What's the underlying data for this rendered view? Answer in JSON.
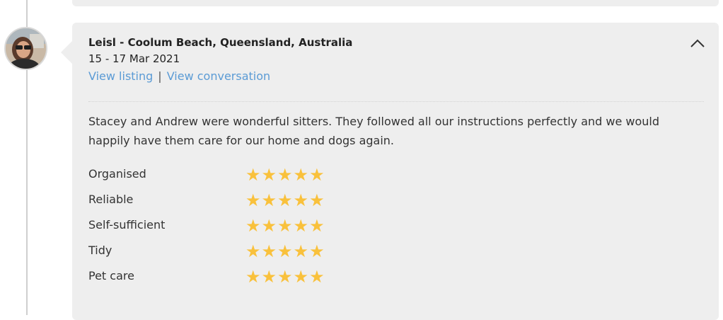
{
  "review": {
    "reviewer": "Leisl - Coolum Beach, Queensland, Australia",
    "dates": "15 - 17 Mar 2021",
    "view_listing": "View listing",
    "separator": "|",
    "view_conversation": "View conversation",
    "text": "Stacey and Andrew were wonderful sitters. They followed all our instructions perfectly and we would happily have them care for our home and dogs again.",
    "collapse_icon": "chevron-up-icon",
    "avatar_icon": "avatar-photo"
  },
  "ratings": [
    {
      "label": "Organised",
      "stars": "★★★★★",
      "value": 5,
      "max": 5
    },
    {
      "label": "Reliable",
      "stars": "★★★★★",
      "value": 5,
      "max": 5
    },
    {
      "label": "Self-sufficient",
      "stars": "★★★★★",
      "value": 5,
      "max": 5
    },
    {
      "label": "Tidy",
      "stars": "★★★★★",
      "value": 5,
      "max": 5
    },
    {
      "label": "Pet care",
      "stars": "★★★★★",
      "value": 5,
      "max": 5
    }
  ],
  "colors": {
    "link": "#5b9bd5",
    "star": "#f9c13c",
    "card_bg": "#eeeeee"
  }
}
